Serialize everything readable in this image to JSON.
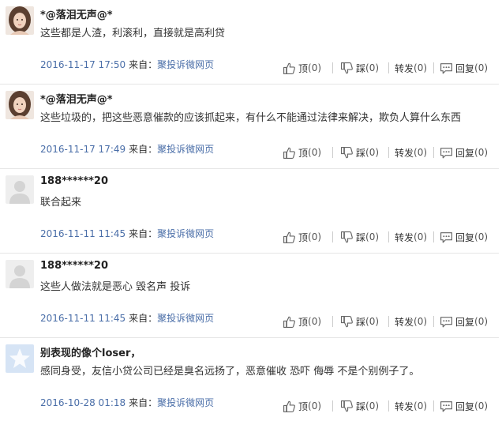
{
  "comments": [
    {
      "user": "*@落泪无声@*",
      "avatar": "photo-avatar",
      "text": "这些都是人渣，利滚利，直接就是高利贷",
      "date": "2016-11-17 17:50",
      "source_label": "来自：",
      "source": "聚投诉微网页",
      "up_label": "顶",
      "up_count": "(0)",
      "down_label": "踩",
      "down_count": "(0)",
      "share_label": "转发",
      "share_count": "(0)",
      "reply_label": "回复",
      "reply_count": "(0)"
    },
    {
      "user": "*@落泪无声@*",
      "avatar": "photo-avatar",
      "text": "这些垃圾的，把这些恶意催款的应该抓起来，有什么不能通过法律来解决，欺负人算什么东西",
      "date": "2016-11-17 17:49",
      "source_label": "来自：",
      "source": "聚投诉微网页",
      "up_label": "顶",
      "up_count": "(0)",
      "down_label": "踩",
      "down_count": "(0)",
      "share_label": "转发",
      "share_count": "(0)",
      "reply_label": "回复",
      "reply_count": "(0)"
    },
    {
      "user": "188******20",
      "avatar": "default-user-avatar",
      "text": "联合起来",
      "date": "2016-11-11 11:45",
      "source_label": "来自：",
      "source": "聚投诉微网页",
      "up_label": "顶",
      "up_count": "(0)",
      "down_label": "踩",
      "down_count": "(0)",
      "share_label": "转发",
      "share_count": "(0)",
      "reply_label": "回复",
      "reply_count": "(0)"
    },
    {
      "user": "188******20",
      "avatar": "default-user-avatar",
      "text": "这些人做法就是恶心 毁名声 投诉",
      "date": "2016-11-11 11:45",
      "source_label": "来自：",
      "source": "聚投诉微网页",
      "up_label": "顶",
      "up_count": "(0)",
      "down_label": "踩",
      "down_count": "(0)",
      "share_label": "转发",
      "share_count": "(0)",
      "reply_label": "回复",
      "reply_count": "(0)"
    },
    {
      "user": "别表现的像个loser，",
      "avatar": "star-avatar",
      "text": "感同身受，友信小贷公司已经是臭名远扬了，恶意催收 恐吓 侮辱 不是个别例子了。",
      "date": "2016-10-28 01:18",
      "source_label": "来自：",
      "source": "聚投诉微网页",
      "up_label": "顶",
      "up_count": "(0)",
      "down_label": "踩",
      "down_count": "(0)",
      "share_label": "转发",
      "share_count": "(0)",
      "reply_label": "回复",
      "reply_count": "(0)"
    }
  ],
  "icons": {
    "up": "thumbs-up-icon",
    "down": "thumbs-down-icon",
    "reply": "speech-bubble-icon"
  },
  "colors": {
    "link": "#4a6ea8",
    "divider": "#e6e6e6",
    "star_avatar_bg": "#d6e4f5"
  }
}
